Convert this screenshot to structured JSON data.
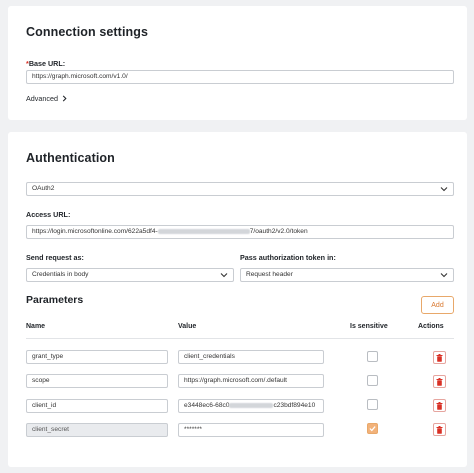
{
  "connection": {
    "title": "Connection settings",
    "base_url_required": "*",
    "base_url_label": "Base URL:",
    "base_url_value": "https://graph.microsoft.com/v1.0/",
    "advanced_label": "Advanced"
  },
  "auth": {
    "title": "Authentication",
    "type_value": "OAuth2",
    "access_url_label": "Access URL:",
    "access_url_prefix": "https://login.microsoftonline.com/622a5df4-",
    "access_url_suffix": "7/oauth2/v2.0/token",
    "send_request_label": "Send request as:",
    "send_request_value": "Credentials in body",
    "pass_token_label": "Pass authorization token in:",
    "pass_token_value": "Request header"
  },
  "params": {
    "title": "Parameters",
    "add_label": "Add",
    "headers": {
      "name": "Name",
      "value": "Value",
      "sensitive": "Is sensitive",
      "actions": "Actions"
    },
    "rows": [
      {
        "name": "grant_type",
        "value": "client_credentials",
        "sensitive": false
      },
      {
        "name": "scope",
        "value": "https://graph.microsoft.com/.default",
        "sensitive": false
      },
      {
        "name": "client_id",
        "value_prefix": "e3448ec6-68c0",
        "value_suffix": "c23bdf894e10",
        "sensitive": false
      },
      {
        "name": "client_secret",
        "value": "*******",
        "sensitive": true
      }
    ]
  },
  "colors": {
    "accent": "#d9782f",
    "danger": "#d93025",
    "checked": "#f2b27a"
  },
  "icons": {
    "advanced": "chevron-right-icon",
    "select": "chevron-down-icon",
    "delete": "trash-icon",
    "check": "check-icon"
  }
}
